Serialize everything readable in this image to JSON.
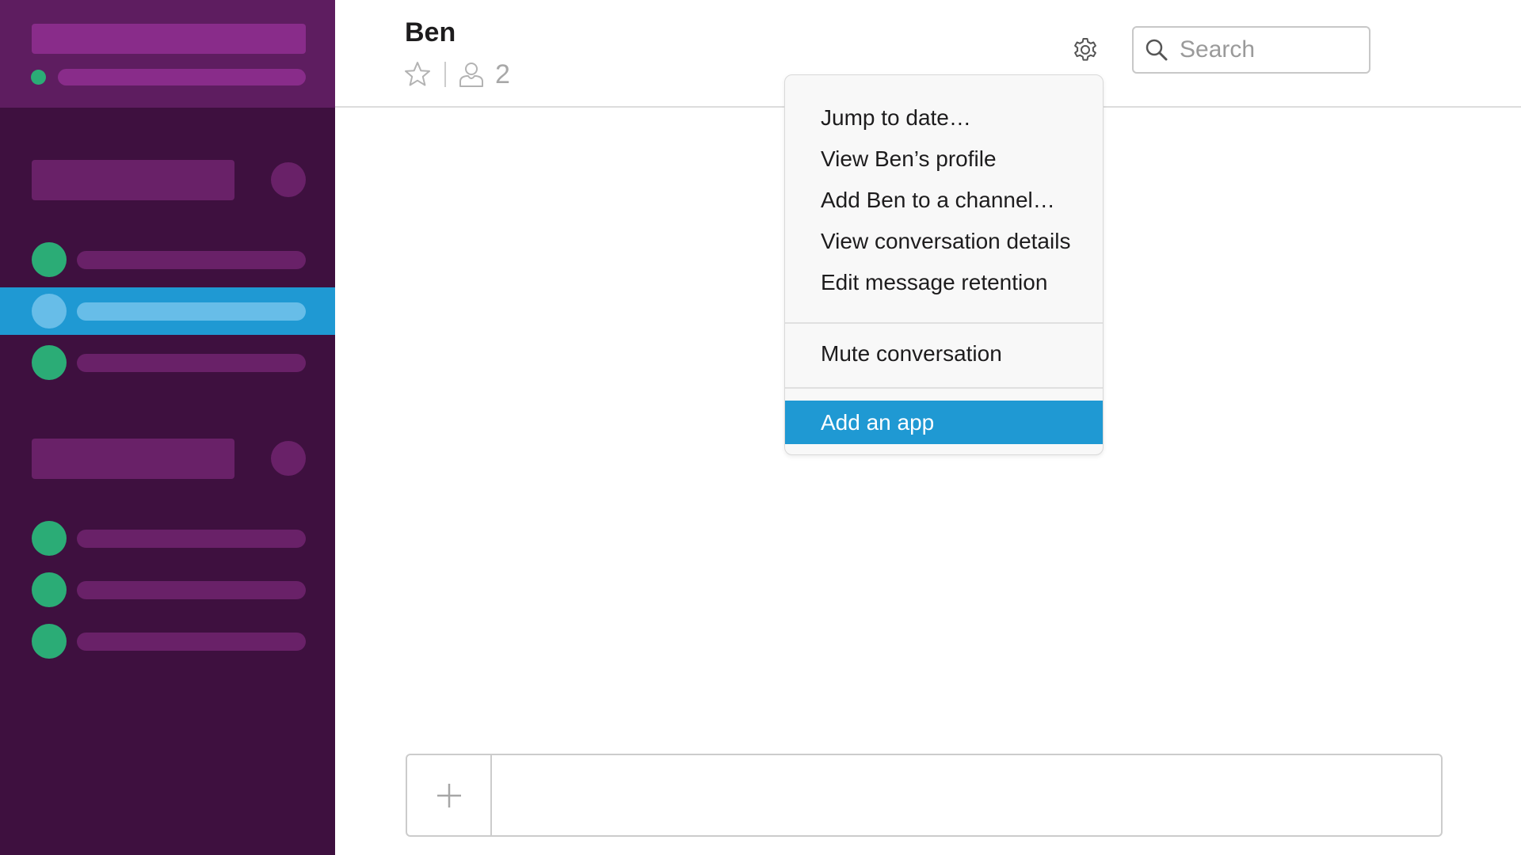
{
  "conversation": {
    "title": "Ben",
    "member_count": "2"
  },
  "search": {
    "placeholder": "Search",
    "value": ""
  },
  "menu": {
    "items": [
      "Jump to date…",
      "View Ben’s profile",
      "Add Ben to a channel…",
      "View conversation details",
      "Edit message retention",
      "Mute conversation",
      "Add an app"
    ],
    "highlighted_item": "Add an app"
  },
  "composer": {
    "value": ""
  },
  "colors": {
    "sidebar_bg": "#3e103f",
    "sidebar_header": "#5e1d60",
    "accent": "#1f99d3",
    "presence": "#2bac76"
  },
  "icons": {
    "star": "star-icon",
    "member": "member-icon",
    "gear": "gear-icon",
    "search": "search-icon",
    "plus": "plus-icon"
  }
}
